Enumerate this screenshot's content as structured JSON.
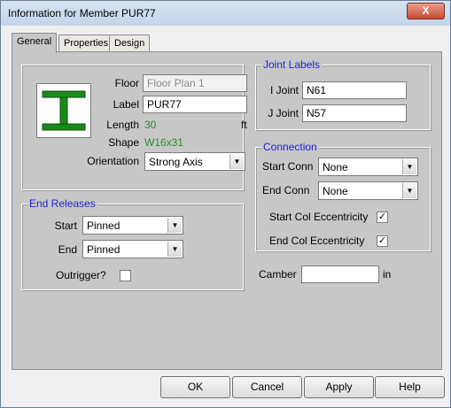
{
  "window": {
    "title": "Information for Member PUR77",
    "close_label": "X"
  },
  "tabs": [
    {
      "label": "General",
      "active": true
    },
    {
      "label": "Properties",
      "active": false
    },
    {
      "label": "Design",
      "active": false
    }
  ],
  "member": {
    "beam_icon": "wide-flange-beam-icon",
    "floor_label": "Floor",
    "floor_value": "Floor Plan 1",
    "label_label": "Label",
    "label_value": "PUR77",
    "length_label": "Length",
    "length_value": "30",
    "length_unit": "ft",
    "shape_label": "Shape",
    "shape_value": "W16x31",
    "orientation_label": "Orientation",
    "orientation_value": "Strong Axis"
  },
  "end_releases": {
    "title": "End Releases",
    "start_label": "Start",
    "start_value": "Pinned",
    "end_label": "End",
    "end_value": "Pinned",
    "outrigger_label": "Outrigger?",
    "outrigger_checked": false
  },
  "joint_labels": {
    "title": "Joint Labels",
    "i_label": "I Joint",
    "i_value": "N61",
    "j_label": "J Joint",
    "j_value": "N57"
  },
  "connection": {
    "title": "Connection",
    "start_conn_label": "Start Conn",
    "start_conn_value": "None",
    "end_conn_label": "End Conn",
    "end_conn_value": "None",
    "start_ecc_label": "Start Col Eccentricity",
    "start_ecc_checked": true,
    "end_ecc_label": "End Col Eccentricity",
    "end_ecc_checked": true
  },
  "camber": {
    "label": "Camber",
    "value": "",
    "unit": "in"
  },
  "buttons": {
    "ok": "OK",
    "cancel": "Cancel",
    "apply": "Apply",
    "help": "Help"
  },
  "colors": {
    "group_title": "#1f1fd6",
    "value_green": "#2a8a2a",
    "beam_green": "#1b8a1b"
  }
}
